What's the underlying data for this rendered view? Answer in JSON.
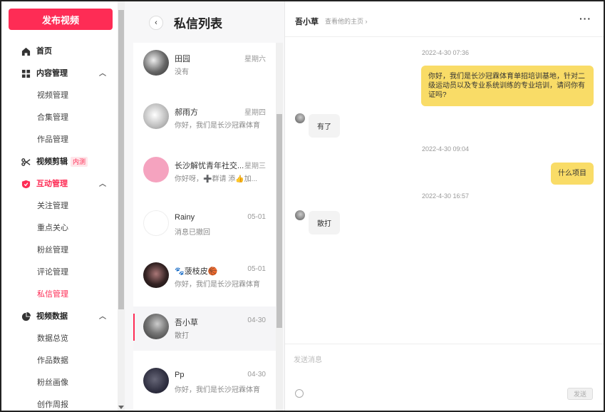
{
  "sidebar": {
    "publish_label": "发布视频",
    "items": [
      {
        "label": "首页",
        "icon": "home-icon"
      },
      {
        "label": "内容管理",
        "icon": "grid-icon"
      },
      {
        "label": "视频管理"
      },
      {
        "label": "合集管理"
      },
      {
        "label": "作品管理"
      },
      {
        "label": "视频剪辑",
        "icon": "scissors-icon",
        "tag": "内测"
      },
      {
        "label": "互动管理",
        "icon": "interaction-icon"
      },
      {
        "label": "关注管理"
      },
      {
        "label": "重点关心"
      },
      {
        "label": "粉丝管理"
      },
      {
        "label": "评论管理"
      },
      {
        "label": "私信管理"
      },
      {
        "label": "视频数据",
        "icon": "pie-chart-icon"
      },
      {
        "label": "数据总览"
      },
      {
        "label": "作品数据"
      },
      {
        "label": "粉丝画像"
      },
      {
        "label": "创作周报"
      }
    ]
  },
  "message_list": {
    "title": "私信列表",
    "conversations": [
      {
        "name": "田园",
        "time": "星期六",
        "preview": "没有"
      },
      {
        "name": "郝雨方",
        "time": "星期四",
        "preview": "你好，我们是长沙冠霖体育"
      },
      {
        "name": "长沙解忧青年社交...",
        "time": "星期三",
        "preview": "你好呀，➕群请 添👍加..."
      },
      {
        "name": "Rainy",
        "time": "05-01",
        "preview": "消息已撤回"
      },
      {
        "name": "🐾菠枝皮🏀",
        "time": "05-01",
        "preview": "你好，我们是长沙冠霖体育"
      },
      {
        "name": "吾小草",
        "time": "04-30",
        "preview": "散打"
      },
      {
        "name": "Pp",
        "time": "04-30",
        "preview": "你好，我们是长沙冠霖体育"
      }
    ]
  },
  "chat": {
    "name": "吾小草",
    "homepage_link": "查看他的主页 ›",
    "more": "···",
    "messages": [
      {
        "timestamp": "2022-4-30 07:36"
      },
      {
        "dir": "out",
        "text": "你好，我们是长沙冠霖体育单招培训基地，针对二级运动员以及专业系统训练的专业培训，请问你有证吗?"
      },
      {
        "dir": "in",
        "text": "有了"
      },
      {
        "timestamp": "2022-4-30 09:04"
      },
      {
        "dir": "out",
        "text": "什么项目"
      },
      {
        "timestamp": "2022-4-30 16:57"
      },
      {
        "dir": "in",
        "text": "散打"
      }
    ],
    "input_placeholder": "发送消息",
    "send_label": "发送"
  },
  "colors": {
    "accent": "#fe2c55",
    "outgoing_bubble": "#f9dc67"
  }
}
